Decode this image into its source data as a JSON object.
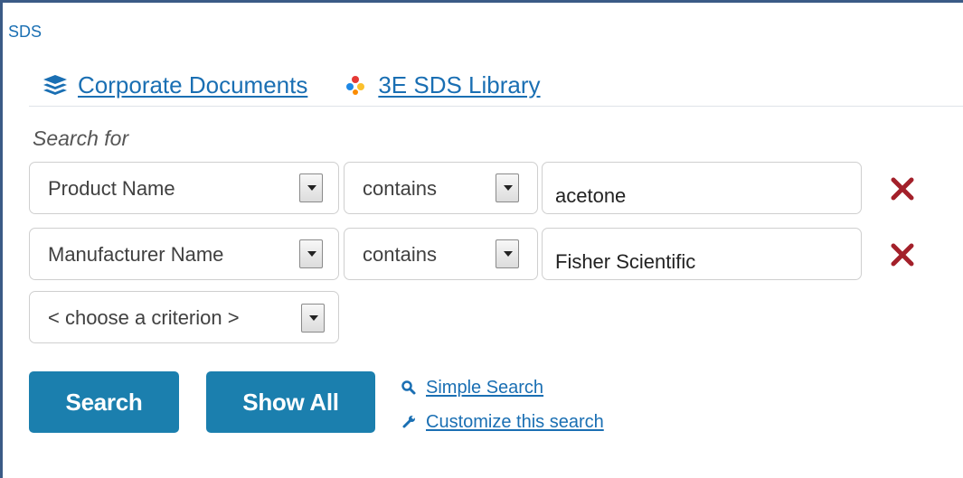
{
  "header": {
    "label": "SDS"
  },
  "tabs": [
    {
      "label": "Corporate Documents",
      "icon": "layers-icon"
    },
    {
      "label": "3E SDS Library",
      "icon": "3e-logo-icon"
    }
  ],
  "search": {
    "heading": "Search for",
    "criteria": [
      {
        "field": "Product Name",
        "operator": "contains",
        "value": "acetone"
      },
      {
        "field": "Manufacturer Name",
        "operator": "contains",
        "value": "Fisher Scientific"
      }
    ],
    "new_criterion_placeholder": "< choose a criterion >"
  },
  "buttons": {
    "search": "Search",
    "show_all": "Show All"
  },
  "links": {
    "simple_search": "Simple Search",
    "customize": "Customize this search"
  },
  "colors": {
    "accent": "#1b7fae",
    "link": "#1a6fb3",
    "remove": "#a3202a",
    "frame": "#3b5b86"
  }
}
